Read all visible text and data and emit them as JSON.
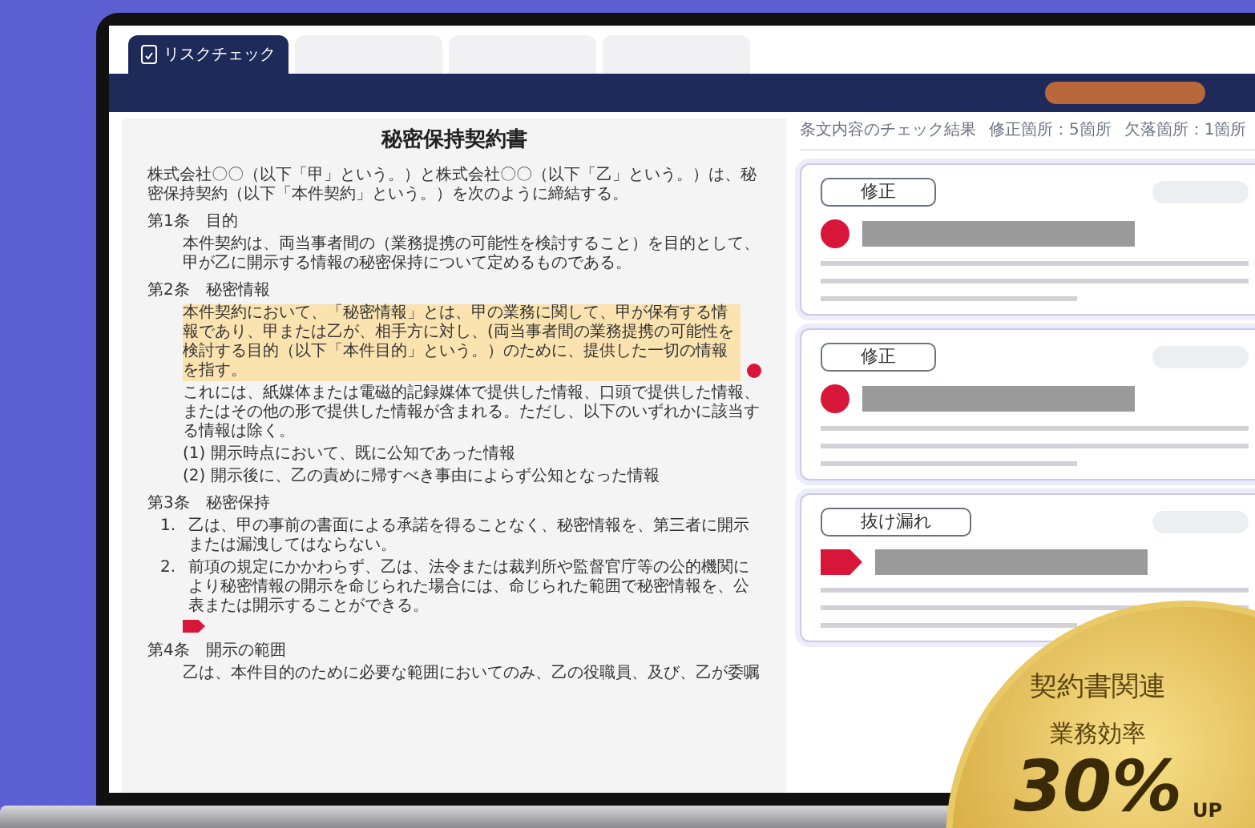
{
  "tabs": [
    {
      "label": "リスクチェック",
      "selected": true
    },
    {
      "selected": false
    },
    {
      "selected": false
    },
    {
      "selected": false
    }
  ],
  "document": {
    "title": "秘密保持契約書",
    "blocks": [
      {
        "kind": "para",
        "text": "株式会社〇〇（以下「甲」という。）と株式会社〇〇（以下「乙」という。）は、秘密保持契約（以下「本件契約」という。）を次のように締結する。"
      },
      {
        "kind": "article",
        "text": "第1条　目的"
      },
      {
        "kind": "body",
        "text": "本件契約は、両当事者間の（業務提携の可能性を検討すること）を目的として、甲が乙に開示する情報の秘密保持について定めるものである。"
      },
      {
        "kind": "article",
        "text": "第2条　秘密情報"
      },
      {
        "kind": "body",
        "text": "本件契約において、「秘密情報」とは、甲の業務に関して、甲が保有する情報であり、甲または乙が、相手方に対し、(両当事者間の業務提携の可能性を検討する目的（以下「本件目的」という。）のために、提供した一切の情報を指す。",
        "highlighted": true,
        "flagged": true
      },
      {
        "kind": "body",
        "text": "これには、紙媒体または電磁的記録媒体で提供した情報、口頭で提供した情報、またはその他の形で提供した情報が含まれる。ただし、以下のいずれかに該当する情報は除く。",
        "highlighted": false
      },
      {
        "kind": "body",
        "text": "(1) 開示時点において、既に公知であった情報"
      },
      {
        "kind": "body",
        "text": "(2) 開示後に、乙の責めに帰すべき事由によらず公知となった情報"
      },
      {
        "kind": "article",
        "text": "第3条　秘密保持"
      },
      {
        "kind": "numbered",
        "number": "1.",
        "text": "乙は、甲の事前の書面による承諾を得ることなく、秘密情報を、第三者に開示または漏洩してはならない。"
      },
      {
        "kind": "numbered",
        "number": "2.",
        "text": "前項の規定にかかわらず、乙は、法令または裁判所や監督官庁等の公的機関により秘密情報の開示を命じられた場合には、命じられた範囲で秘密情報を、公表または開示することができる。"
      },
      {
        "kind": "tag_marker"
      },
      {
        "kind": "article",
        "text": "第4条　開示の範囲"
      },
      {
        "kind": "body",
        "text": "乙は、本件目的のために必要な範囲においてのみ、乙の役職員、及び、乙が委嘱"
      }
    ]
  },
  "results": {
    "heading": "条文内容のチェック結果",
    "fix_count": "修正箇所：5箇所",
    "missing_count": "欠落箇所：1箇所"
  },
  "cards": [
    {
      "label": "修正",
      "kind": "circle"
    },
    {
      "label": "修正",
      "kind": "circle"
    },
    {
      "label": "抜け漏れ",
      "kind": "tag"
    }
  ],
  "badge": {
    "line_1": "契約書関連",
    "line_2": "業務効率",
    "figure": "30%",
    "suffix": "UP"
  }
}
